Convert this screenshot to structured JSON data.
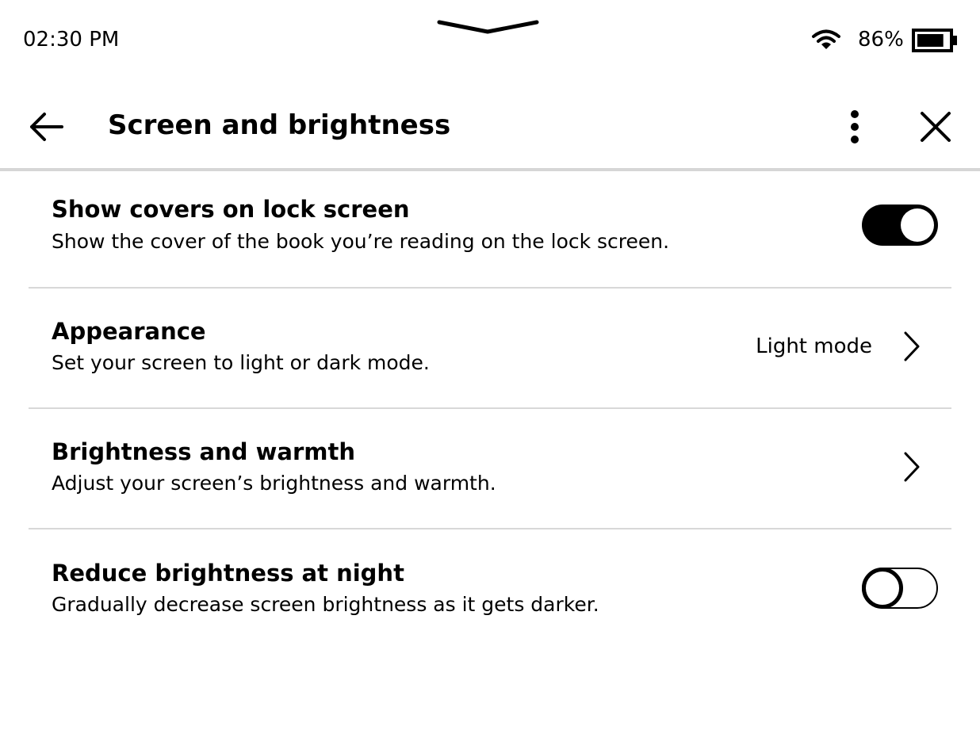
{
  "status_bar": {
    "time": "02:30 PM",
    "battery_percent": "86%",
    "battery_level": 0.86,
    "icons": [
      "pull-down-handle-icon",
      "wifi-icon",
      "battery-icon"
    ]
  },
  "header": {
    "title": "Screen and brightness",
    "icons": [
      "back-arrow-icon",
      "more-options-icon",
      "close-icon"
    ]
  },
  "settings": [
    {
      "title": "Show covers on lock screen",
      "subtitle": "Show the cover of the book you’re reading on the lock screen.",
      "control": "toggle",
      "enabled": true
    },
    {
      "title": "Appearance",
      "subtitle": "Set your screen to light or dark mode.",
      "control": "chevron",
      "value": "Light mode"
    },
    {
      "title": "Brightness and warmth",
      "subtitle": "Adjust your screen’s brightness and warmth.",
      "control": "chevron"
    },
    {
      "title": "Reduce brightness at night",
      "subtitle": "Gradually decrease screen brightness as it gets darker.",
      "control": "toggle",
      "enabled": false
    }
  ],
  "colors": {
    "text": "#000000",
    "background": "#ffffff",
    "divider": "#d8d8d8"
  }
}
